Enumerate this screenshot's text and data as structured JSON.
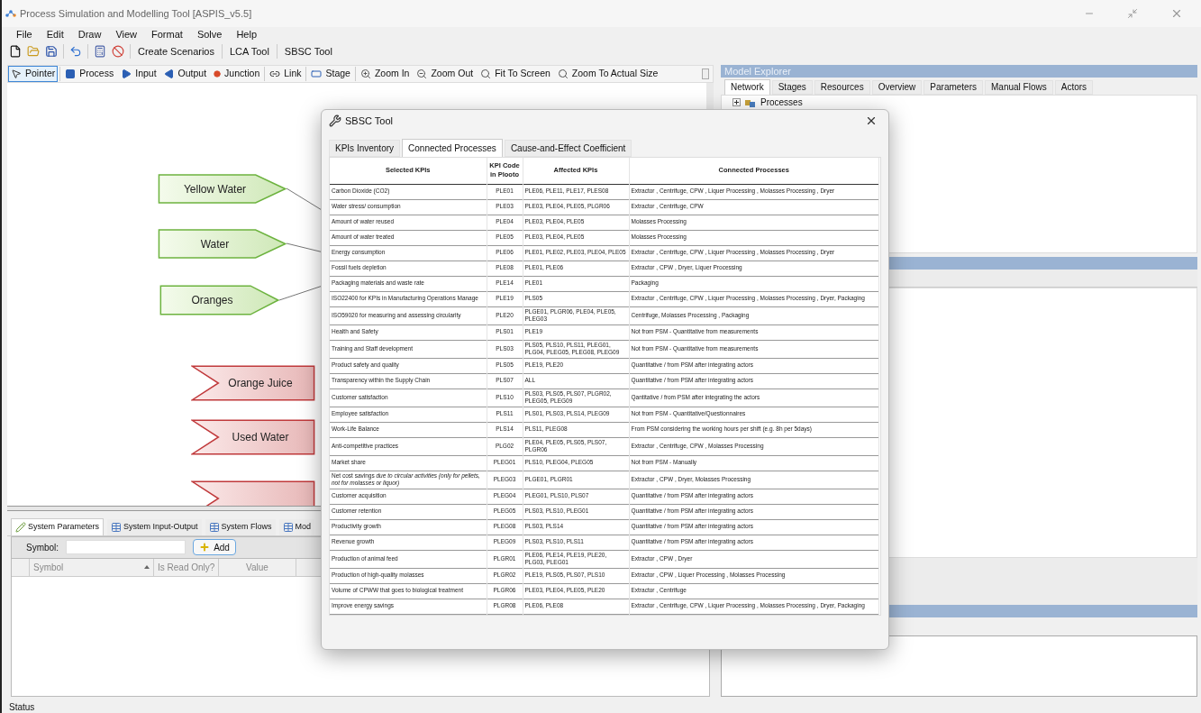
{
  "window": {
    "title": "Process Simulation and Modelling Tool [ASPIS_v5.5]"
  },
  "menu": [
    "File",
    "Edit",
    "Draw",
    "View",
    "Format",
    "Solve",
    "Help"
  ],
  "toolbar": [
    "Create Scenarios",
    "LCA Tool",
    "SBSC Tool"
  ],
  "draw_toolbar": [
    {
      "label": "Pointer",
      "selected": true
    },
    {
      "label": "Process",
      "selected": false
    },
    {
      "label": "Input",
      "selected": false
    },
    {
      "label": "Output",
      "selected": false
    },
    {
      "label": "Junction",
      "selected": false
    },
    {
      "label": "Link",
      "selected": false
    },
    {
      "label": "Stage",
      "selected": false
    },
    {
      "label": "Zoom In",
      "selected": false
    },
    {
      "label": "Zoom Out",
      "selected": false
    },
    {
      "label": "Fit To Screen",
      "selected": false
    },
    {
      "label": "Zoom To Actual Size",
      "selected": false
    }
  ],
  "canvas": {
    "nodes": [
      {
        "kind": "input",
        "label": "Yellow Water"
      },
      {
        "kind": "input",
        "label": "Water"
      },
      {
        "kind": "input",
        "label": "Oranges"
      },
      {
        "kind": "output",
        "label": "Orange Juice"
      },
      {
        "kind": "output",
        "label": "Used Water"
      },
      {
        "kind": "output"
      }
    ]
  },
  "model_explorer": {
    "title": "Model Explorer",
    "tabs": [
      {
        "label": "Network",
        "selected": true
      },
      {
        "label": "Stages",
        "selected": false
      },
      {
        "label": "Resources",
        "selected": false
      },
      {
        "label": "Overview",
        "selected": false
      },
      {
        "label": "Parameters",
        "selected": false
      },
      {
        "label": "Manual Flows",
        "selected": false
      },
      {
        "label": "Actors",
        "selected": false
      }
    ],
    "tree": [
      {
        "label": "Processes",
        "expanded": false
      }
    ]
  },
  "bottom_panel": {
    "tabs": [
      {
        "label": "System Parameters",
        "selected": true
      },
      {
        "label": "System Input-Output",
        "selected": false
      },
      {
        "label": "System Flows",
        "selected": false
      },
      {
        "label": "Mod",
        "selected": false
      }
    ],
    "symbol_label": "Symbol:",
    "add_button": "Add",
    "columns": [
      "Symbol",
      "Is Read Only?",
      "Value"
    ]
  },
  "status_bar": "Status",
  "dialog": {
    "title": "SBSC Tool",
    "tabs": [
      {
        "label": "KPIs Inventory",
        "selected": false
      },
      {
        "label": "Connected Processes",
        "selected": true
      },
      {
        "label": "Cause-and-Effect Coefficient",
        "selected": false
      }
    ],
    "columns": [
      "Selected KPIs",
      "KPI Code in Plooto",
      "Affected KPIs",
      "Connected Processes"
    ],
    "rows": [
      [
        "Carbon Dioxide (CO2)",
        "PLE01",
        "PLE06, PLE11, PLE17, PLES08",
        "Extractor , Centrifuge, CPW , Liquer Processing , Molasses Processing , Dryer"
      ],
      [
        "Water stress/ consumption",
        "PLE03",
        "PLE03, PLE04, PLE05, PLGR06",
        "Extractor , Centrifuge, CPW"
      ],
      [
        "Amount of water reused",
        "PLE04",
        "PLE03, PLE04, PLE05",
        "Molasses Processing"
      ],
      [
        "Amount of water treated",
        "PLE05",
        "PLE03, PLE04, PLE05",
        "Molasses Processing"
      ],
      [
        "Energy consumption",
        "PLE06",
        "PLE01, PLE02, PLE03, PLE04, PLE05",
        "Extractor , Centrifuge, CPW , Liquer Processing , Molasses Processing , Dryer"
      ],
      [
        "Fossil fuels depletion",
        "PLE08",
        "PLE01, PLE06",
        "Extractor , CPW , Dryer, Liquer Processing"
      ],
      [
        "Packaging materials and waste rate",
        "PLE14",
        "PLE01",
        "Packaging"
      ],
      [
        "ISO22400 for KPIs in Manufacturing Operations Manage",
        "PLE19",
        "PLS05",
        "Extractor , Centrifuge, CPW , Liquer Processing , Molasses Processing , Dryer, Packaging"
      ],
      [
        "ISO59020 for measuring and assessing circularity",
        "PLE20",
        "PLGE01, PLGR06, PLE04, PLE05, PLEG03",
        "Centrifuge, Molasses Processing , Packaging"
      ],
      [
        "Health and Safety",
        "PLS01",
        "PLE19",
        "Not from PSM - Quantitative from measurements"
      ],
      [
        "Training and Staff development",
        "PLS03",
        "PLS05, PLS10, PLS11, PLEG01, PLG04, PLEG05, PLEG08, PLEG09",
        "Not from PSM - Quantitative from measurements"
      ],
      [
        "Product safety and quality",
        "PLS05",
        "PLE19, PLE20",
        "Quantitative / from PSM after integrating actors"
      ],
      [
        "Transparency within the Supply Chain",
        "PLS07",
        "ALL",
        "Quantitative / from PSM after integrating actors"
      ],
      [
        "Customer satisfaction",
        "PLS10",
        "PLS03, PLS05, PLS07, PLGR02, PLEG05, PLEG09",
        "Qantitative / from PSM after integrating the actors"
      ],
      [
        "Employee satisfaction",
        "PLS11",
        "PLS01, PLS03, PLS14, PLEG09",
        "Not from PSM - Quantitative/Questionnaires"
      ],
      [
        "Work-Life Balance",
        "PLS14",
        "PLS11, PLEG08",
        "From PSM considering the working hours per shift (e.g. 8h per 5days)"
      ],
      [
        "Anti-competitive practices",
        "PLG02",
        "PLE04, PLE05, PLS05, PLS07, PLGR06",
        "Extractor , Centrifuge, CPW , Molasses Processing"
      ],
      [
        "Market share",
        "PLEG01",
        "PLS10, PLEG04, PLEG05",
        "Not from PSM - Manually"
      ],
      [
        "Net cost savings *due to circular activities (only for pellets, not for molasses or liquor)*",
        "PLEG03",
        "PLGE01, PLGR01",
        "Extractor , CPW , Dryer, Molasses Processing"
      ],
      [
        "Customer acquisition",
        "PLEG04",
        "PLEG01, PLS10, PLS07",
        "Quantitative / from PSM after integrating actors"
      ],
      [
        "Customer retention",
        "PLEG05",
        "PLS03, PLS10, PLEG01",
        "Quantitative / from PSM after integrating actors"
      ],
      [
        "Productivity growth",
        "PLEG08",
        "PLS03, PLS14",
        "Quantitative / from PSM after integrating actors"
      ],
      [
        "Revenue growth",
        "PLEG09",
        "PLS03, PLS10, PLS11",
        "Quantitative / from PSM after integrating actors"
      ],
      [
        "Production of animal feed",
        "PLGR01",
        "PLE06, PLE14, PLE19, PLE20, PLG03, PLEG01",
        "Extractor , CPW , Dryer"
      ],
      [
        "Production of high-quality molasses",
        "PLGR02",
        "PLE19, PLS05, PLS07, PLS10",
        "Extractor , CPW , Liquer Processing , Molasses Processing"
      ],
      [
        "Volume of CPWW that goes to biological treatment",
        "PLGR06",
        "PLE03, PLE04, PLE05, PLE20",
        "Extractor , Centrifuge"
      ],
      [
        "Improve energy savings",
        "PLGR08",
        "PLE06, PLE08",
        "Extractor , Centrifuge, CPW , Liquer Processing , Molasses Processing , Dryer, Packaging"
      ]
    ]
  }
}
